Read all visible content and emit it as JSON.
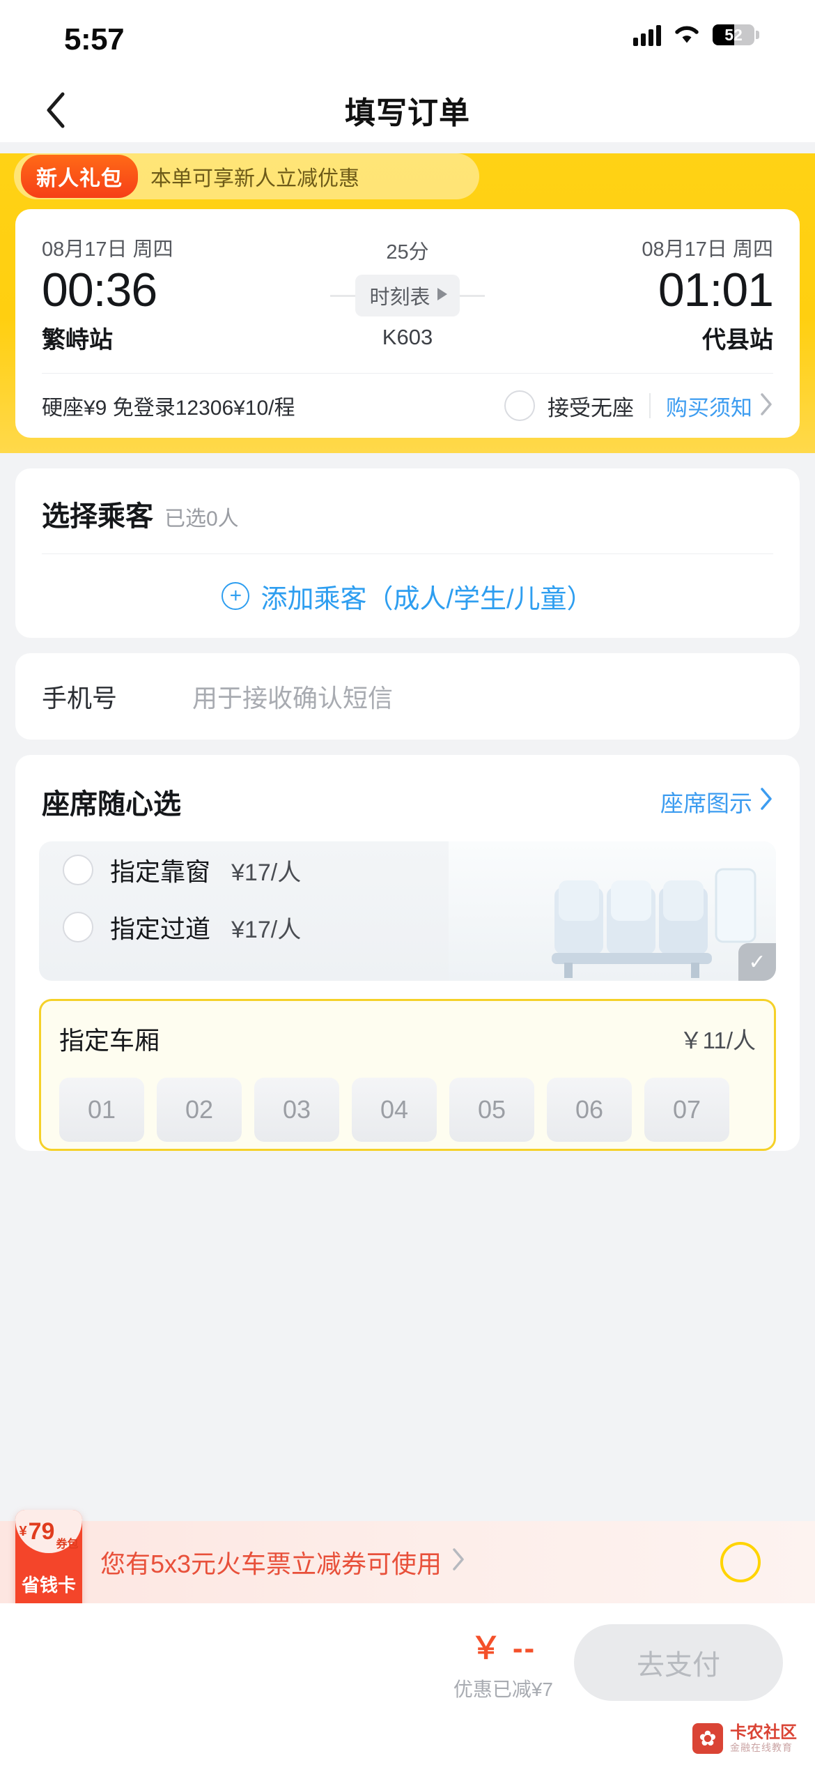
{
  "status_bar": {
    "time": "5:57",
    "battery_percent": "52",
    "signal_icon": "cellular-bars-icon",
    "wifi_icon": "wifi-icon",
    "battery_icon": "battery-icon"
  },
  "nav": {
    "back_icon": "chevron-left-icon",
    "title": "填写订单"
  },
  "promo": {
    "badge": "新人礼包",
    "text": "本单可享新人立减优惠"
  },
  "train": {
    "depart_date": "08月17日 周四",
    "depart_time": "00:36",
    "depart_station": "繁峙站",
    "duration": "25分",
    "schedule_label": "时刻表",
    "schedule_icon": "play-triangle-icon",
    "train_no": "K603",
    "arrive_date": "08月17日 周四",
    "arrive_time": "01:01",
    "arrive_station": "代县站",
    "seat_price": "硬座¥9  免登录12306¥10/程",
    "no_seat_label": "接受无座",
    "no_seat_radio_icon": "radio-unchecked-icon",
    "notice_label": "购买须知",
    "notice_chevron_icon": "chevron-right-icon"
  },
  "passenger": {
    "title": "选择乘客",
    "count": "已选0人",
    "add_label": "添加乘客（成人/学生/儿童）",
    "add_icon": "plus-circle-icon"
  },
  "phone": {
    "label": "手机号",
    "value": "",
    "placeholder": "用于接收确认短信"
  },
  "seat": {
    "title": "座席随心选",
    "legend_label": "座席图示",
    "legend_chevron_icon": "chevron-right-icon",
    "options": [
      {
        "label": "指定靠窗",
        "price": "¥17/人",
        "radio_icon": "radio-unchecked-icon"
      },
      {
        "label": "指定过道",
        "price": "¥17/人",
        "radio_icon": "radio-unchecked-icon"
      }
    ],
    "image_icon": "train-seats-photo",
    "image_check_icon": "check-icon",
    "car": {
      "title": "指定车厢",
      "price": "￥11/人",
      "chips": [
        "01",
        "02",
        "03",
        "04",
        "05",
        "06",
        "07"
      ]
    }
  },
  "coupon": {
    "card_currency": "¥",
    "card_amount": "79",
    "card_unit": "券包",
    "card_name": "省钱卡",
    "text": "您有5x3元火车票立减券可使用",
    "chevron_icon": "chevron-right-icon",
    "toggle_icon": "radio-unchecked-icon"
  },
  "paybar": {
    "price": "￥ --",
    "discount_note": "优惠已减¥7",
    "button_label": "去支付"
  },
  "watermark": {
    "icon": "flower-logo-icon",
    "title": "卡农社区",
    "subtitle": "金融在线教育"
  },
  "colors": {
    "brand_yellow": "#ffd215",
    "link_blue": "#3c9cf0",
    "accent_red": "#f4452a",
    "price_orange": "#f4502a",
    "card_border_yellow": "#f5d128"
  }
}
